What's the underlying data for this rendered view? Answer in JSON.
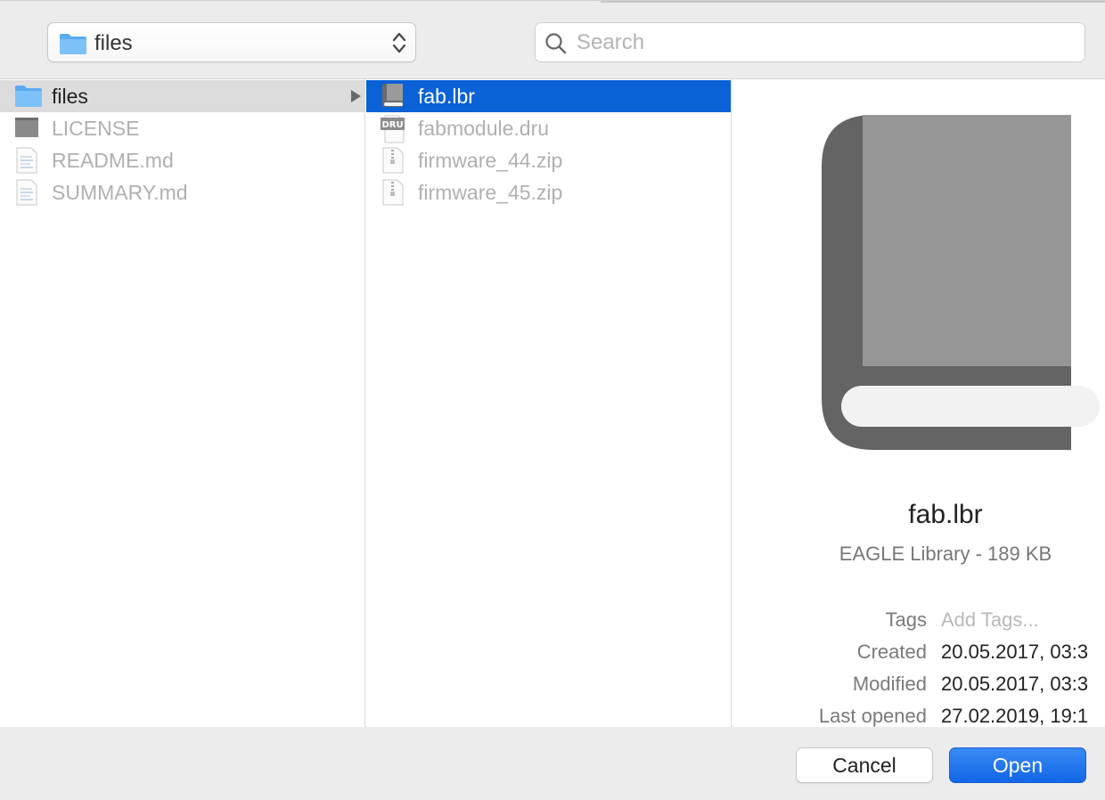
{
  "toolbar": {
    "location_label": "files",
    "search_placeholder": "Search"
  },
  "column1": {
    "items": [
      {
        "label": "files",
        "icon": "folder-icon",
        "state": "selected-inactive",
        "has_children": true
      },
      {
        "label": "LICENSE",
        "icon": "generic-document-icon",
        "state": "disabled"
      },
      {
        "label": "README.md",
        "icon": "text-document-icon",
        "state": "disabled"
      },
      {
        "label": "SUMMARY.md",
        "icon": "text-document-icon",
        "state": "disabled"
      }
    ]
  },
  "column2": {
    "items": [
      {
        "label": "fab.lbr",
        "icon": "eagle-library-icon",
        "state": "selected"
      },
      {
        "label": "fabmodule.dru",
        "icon": "dru-document-icon",
        "state": "disabled",
        "badge": "DRU"
      },
      {
        "label": "firmware_44.zip",
        "icon": "zip-archive-icon",
        "state": "disabled"
      },
      {
        "label": "firmware_45.zip",
        "icon": "zip-archive-icon",
        "state": "disabled"
      }
    ]
  },
  "preview": {
    "file_name": "fab.lbr",
    "kind_size": "EAGLE Library - 189 KB",
    "meta": [
      {
        "key": "Tags",
        "value": "Add Tags..."
      },
      {
        "key": "Created",
        "value": "20.05.2017, 03:3"
      },
      {
        "key": "Modified",
        "value": "20.05.2017, 03:3"
      },
      {
        "key": "Last opened",
        "value": "27.02.2019, 19:1"
      }
    ]
  },
  "buttons": {
    "cancel": "Cancel",
    "open": "Open"
  },
  "colors": {
    "selection_blue": "#0b62d6",
    "folder_blue": "#6cb6f5",
    "accent_button": "#1266e6"
  }
}
